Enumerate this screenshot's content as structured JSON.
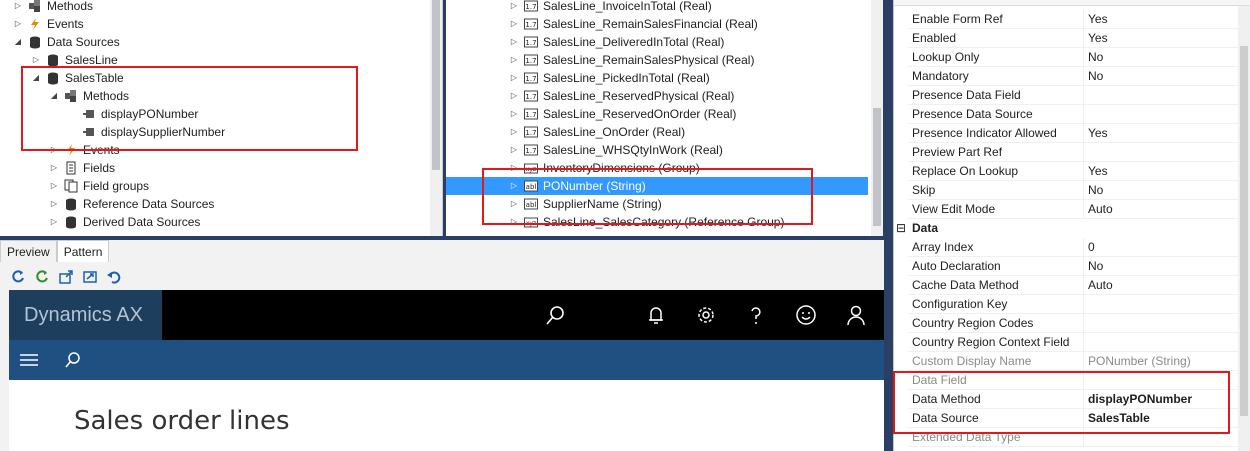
{
  "left_tree": {
    "nodes": [
      {
        "label": "Methods",
        "arrow": "▷",
        "icon": "methods-icon"
      },
      {
        "label": "Events",
        "arrow": "▷",
        "icon": "events-icon"
      },
      {
        "label": "Data Sources",
        "arrow": "◢",
        "icon": "datasource-icon"
      },
      {
        "label": "SalesLine",
        "arrow": "▷",
        "icon": "datasource-icon"
      },
      {
        "label": "SalesTable",
        "arrow": "◢",
        "icon": "datasource-icon"
      },
      {
        "label": "Methods",
        "arrow": "◢",
        "icon": "methods-icon"
      },
      {
        "label": "displayPONumber",
        "arrow": "",
        "icon": "method-icon"
      },
      {
        "label": "displaySupplierNumber",
        "arrow": "",
        "icon": "method-icon"
      },
      {
        "label": "Events",
        "arrow": "▷",
        "icon": "events-icon"
      },
      {
        "label": "Fields",
        "arrow": "▷",
        "icon": "fields-icon"
      },
      {
        "label": "Field groups",
        "arrow": "▷",
        "icon": "fieldgroups-icon"
      },
      {
        "label": "Reference Data Sources",
        "arrow": "▷",
        "icon": "datasource-icon"
      },
      {
        "label": "Derived Data Sources",
        "arrow": "▷",
        "icon": "datasource-icon"
      }
    ]
  },
  "mid_tree": {
    "nodes": [
      {
        "label": "SalesLine_InvoiceInTotal (Real)",
        "icon": "real-field-icon"
      },
      {
        "label": "SalesLine_RemainSalesFinancial (Real)",
        "icon": "real-field-icon"
      },
      {
        "label": "SalesLine_DeliveredInTotal (Real)",
        "icon": "real-field-icon"
      },
      {
        "label": "SalesLine_RemainSalesPhysical (Real)",
        "icon": "real-field-icon"
      },
      {
        "label": "SalesLine_PickedInTotal (Real)",
        "icon": "real-field-icon"
      },
      {
        "label": "SalesLine_ReservedPhysical (Real)",
        "icon": "real-field-icon"
      },
      {
        "label": "SalesLine_ReservedOnOrder (Real)",
        "icon": "real-field-icon"
      },
      {
        "label": "SalesLine_OnOrder (Real)",
        "icon": "real-field-icon"
      },
      {
        "label": "SalesLine_WHSQtyInWork (Real)",
        "icon": "real-field-icon"
      },
      {
        "label": "InventoryDimensions (Group)",
        "icon": "group-icon"
      },
      {
        "label": "PONumber (String)",
        "icon": "string-field-icon"
      },
      {
        "label": "SupplierName (String)",
        "icon": "string-field-icon"
      },
      {
        "label": "SalesLine_SalesCategory (Reference Group)",
        "icon": "group-icon"
      }
    ],
    "selected_index": 10
  },
  "preview": {
    "tabs": [
      "Preview",
      "Pattern"
    ],
    "brand": "Dynamics AX",
    "page_title": "Sales order lines"
  },
  "properties": {
    "rows_top": [
      {
        "name": "Enable Form Ref",
        "value": "Yes"
      },
      {
        "name": "Enabled",
        "value": "Yes"
      },
      {
        "name": "Lookup Only",
        "value": "No"
      },
      {
        "name": "Mandatory",
        "value": "No"
      },
      {
        "name": "Presence Data Field",
        "value": ""
      },
      {
        "name": "Presence Data Source",
        "value": ""
      },
      {
        "name": "Presence Indicator Allowed",
        "value": "Yes"
      },
      {
        "name": "Preview Part Ref",
        "value": ""
      },
      {
        "name": "Replace On Lookup",
        "value": "Yes"
      },
      {
        "name": "Skip",
        "value": "No"
      },
      {
        "name": "View Edit Mode",
        "value": "Auto"
      }
    ],
    "group_data": "Data",
    "group_toggle": "⊟",
    "rows_data": [
      {
        "name": "Array Index",
        "value": "0",
        "style": ""
      },
      {
        "name": "Auto Declaration",
        "value": "No",
        "style": ""
      },
      {
        "name": "Cache Data Method",
        "value": "Auto",
        "style": ""
      },
      {
        "name": "Configuration Key",
        "value": "",
        "style": ""
      },
      {
        "name": "Country Region Codes",
        "value": "",
        "style": ""
      },
      {
        "name": "Country Region Context Field",
        "value": "",
        "style": ""
      },
      {
        "name": "Custom Display Name",
        "value": "PONumber (String)",
        "style": "dim"
      },
      {
        "name": "Data Field",
        "value": "",
        "style": "dim"
      },
      {
        "name": "Data Method",
        "value": "displayPONumber",
        "style": "bold"
      },
      {
        "name": "Data Source",
        "value": "SalesTable",
        "style": "bold"
      },
      {
        "name": "Extended Data Type",
        "value": "",
        "style": "dim"
      }
    ]
  },
  "colors": {
    "highlight": "#e0191c",
    "selection": "#3399ff",
    "splitter": "#2a3f63",
    "appbar": "#000000",
    "navbar": "#205081",
    "brand": "#1e3e5e"
  }
}
